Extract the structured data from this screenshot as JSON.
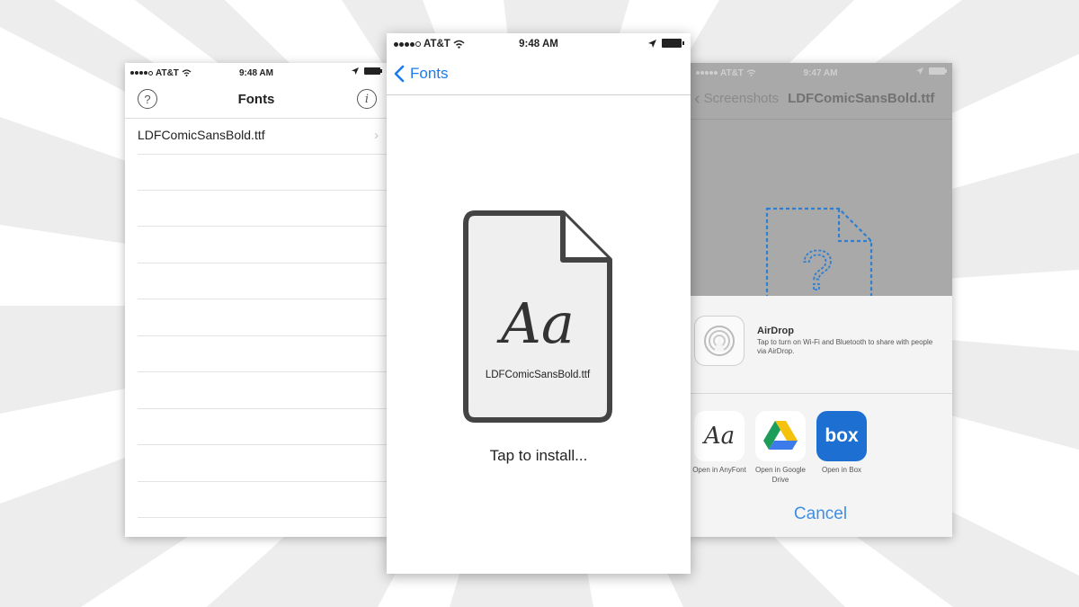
{
  "colors": {
    "accent_blue": "#1a7cf0",
    "cancel_blue": "#3e8ee6",
    "box_blue": "#1d6fd1"
  },
  "left_phone": {
    "status": {
      "carrier": "AT&T",
      "time": "9:48 AM"
    },
    "title": "Fonts",
    "help_icon": "?",
    "info_icon": "i",
    "file_name": "LDFComicSansBold.ttf"
  },
  "center_phone": {
    "status": {
      "carrier": "AT&T",
      "time": "9:48 AM"
    },
    "back_label": "Fonts",
    "doc_glyph": "Aa",
    "doc_name": "LDFComicSansBold.ttf",
    "install_prompt": "Tap to install..."
  },
  "right_phone": {
    "status": {
      "carrier": "AT&T",
      "time": "9:47 AM"
    },
    "back_label": "Screenshots",
    "title": "LDFComicSansBold.ttf",
    "unknown_glyph": "?",
    "airdrop": {
      "title": "AirDrop",
      "description": "Tap to turn on Wi-Fi and Bluetooth to share with people via AirDrop."
    },
    "apps": [
      {
        "icon": "anyfont-icon",
        "glyph": "Aa",
        "label": "Open in AnyFont"
      },
      {
        "icon": "google-drive-icon",
        "glyph": "",
        "label": "Open in Google Drive"
      },
      {
        "icon": "box-icon",
        "glyph": "box",
        "label": "Open in Box"
      }
    ],
    "cancel_label": "Cancel"
  }
}
